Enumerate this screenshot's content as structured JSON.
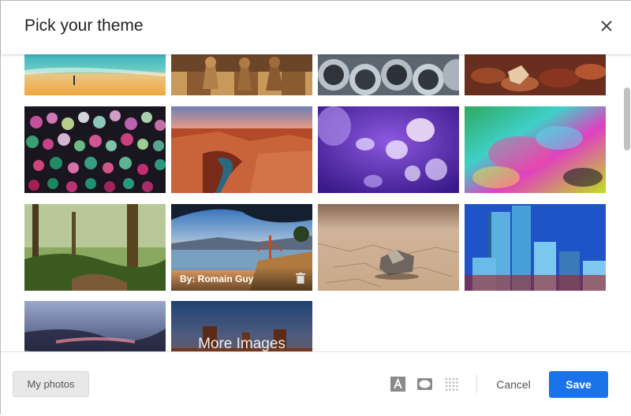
{
  "dialog": {
    "title": "Pick your theme"
  },
  "tiles": [
    {
      "name": "beach"
    },
    {
      "name": "chess"
    },
    {
      "name": "pipes"
    },
    {
      "name": "leaves"
    },
    {
      "name": "bokeh-lights"
    },
    {
      "name": "canyon"
    },
    {
      "name": "jellyfish"
    },
    {
      "name": "colorful-water"
    },
    {
      "name": "forest"
    },
    {
      "name": "golden-gate",
      "credit": "By: Romain Guy"
    },
    {
      "name": "desert-rock"
    },
    {
      "name": "city-buildings"
    },
    {
      "name": "stormy-sky"
    },
    {
      "name": "monument-valley",
      "label": "More Images"
    }
  ],
  "footer": {
    "my_photos": "My photos",
    "cancel": "Cancel",
    "save": "Save"
  },
  "icons": [
    "close-icon",
    "text-color-icon",
    "vignette-icon",
    "blur-icon",
    "trash-icon"
  ],
  "colors": {
    "accent": "#1a73e8"
  }
}
